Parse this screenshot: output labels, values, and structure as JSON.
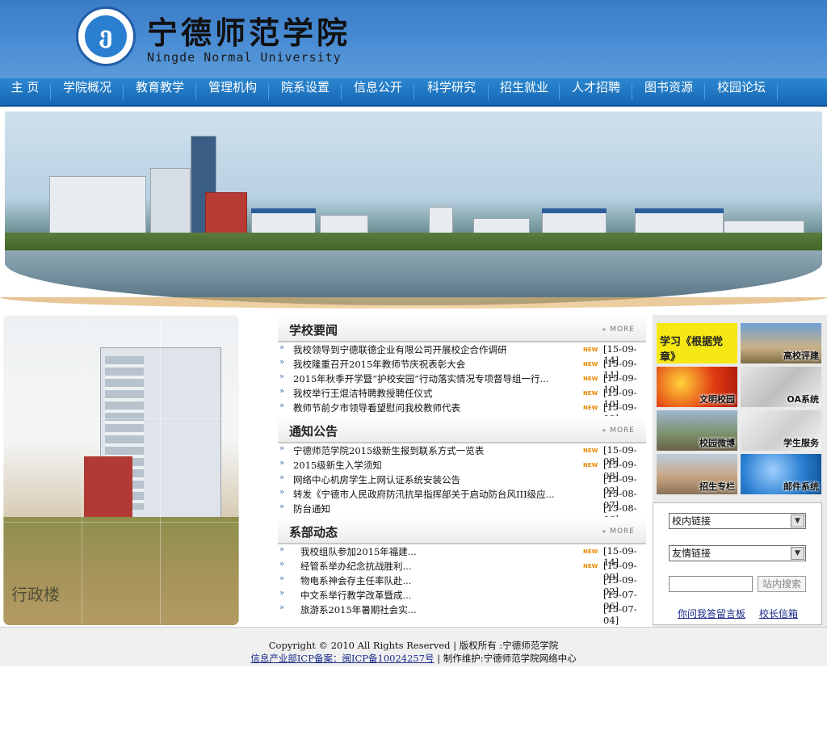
{
  "header": {
    "logo_mark": "ე",
    "title": "宁德师范学院",
    "subtitle": "Ningde Normal University"
  },
  "nav": {
    "items": [
      "主 页",
      "学院概况",
      "教育教学",
      "管理机构",
      "院系设置",
      "信息公开",
      "科学研究",
      "招生就业",
      "人才招聘",
      "图书资源",
      "校园论坛"
    ]
  },
  "left_photo": {
    "caption": "行政楼"
  },
  "news": {
    "school": {
      "title": "学校要闻",
      "more": "MORE",
      "items": [
        {
          "text": "我校领导到宁德联德企业有限公司开展校企合作调研",
          "new": "NEW",
          "date": "[15-09-14]"
        },
        {
          "text": "我校隆重召开2015年教师节庆祝表彰大会",
          "new": "NEW",
          "date": "[15-09-11]"
        },
        {
          "text": "2015年秋季开学暨“护校安园”行动落实情况专项督导组一行...",
          "new": "NEW",
          "date": "[15-09-10]"
        },
        {
          "text": "我校举行王焜洁特聘教授聘任仪式",
          "new": "NEW",
          "date": "[15-09-10]"
        },
        {
          "text": "教师节前夕市领导看望慰问我校教师代表",
          "new": "NEW",
          "date": "[15-09-09]"
        }
      ]
    },
    "notice": {
      "title": "通知公告",
      "more": "MORE",
      "items": [
        {
          "text": "宁德师范学院2015级新生报到联系方式一览表",
          "new": "NEW",
          "date": "[15-09-08]"
        },
        {
          "text": "2015级新生入学须知",
          "new": "NEW",
          "date": "[15-09-08]"
        },
        {
          "text": "网络中心机房学生上网认证系统安装公告",
          "new": "",
          "date": "[15-09-02]"
        },
        {
          "text": "转发《宁德市人民政府防汛抗旱指挥部关于启动防台风III级应...",
          "new": "",
          "date": "[15-08-07]"
        },
        {
          "text": "防台通知",
          "new": "",
          "date": "[15-08-06]"
        }
      ]
    },
    "dept": {
      "title": "系部动态",
      "more": "MORE",
      "items": [
        {
          "text": "我校组队参加2015年福建...",
          "new": "NEW",
          "date": "[15-09-14]"
        },
        {
          "text": "经管系举办纪念抗战胜利...",
          "new": "NEW",
          "date": "[15-09-09]"
        },
        {
          "text": "物电系神会存主任率队赴...",
          "new": "",
          "date": "[15-09-02]"
        },
        {
          "text": "中文系举行教学改革暨成...",
          "new": "",
          "date": "[15-07-06]"
        },
        {
          "text": "旅游系2015年暑期社会实...",
          "new": "",
          "date": "[15-07-04]"
        }
      ]
    }
  },
  "tiles": [
    {
      "label": "学习《根据党章》",
      "icon": "study-banner"
    },
    {
      "label": "高校评建",
      "icon": "building-photo"
    },
    {
      "label": "文明校园",
      "icon": "flag-photo"
    },
    {
      "label": "OA系统",
      "icon": "pen-photo"
    },
    {
      "label": "校园微博",
      "icon": "campus-photo"
    },
    {
      "label": "学生服务",
      "icon": "book-photo"
    },
    {
      "label": "招生专栏",
      "icon": "campus-photo"
    },
    {
      "label": "邮件系统",
      "icon": "mail-photo"
    }
  ],
  "links": {
    "internal_select": "校内链接",
    "friend_select": "友情链接",
    "search_placeholder": "",
    "search_button": "站内搜索",
    "ask_link": "你问我答留言板",
    "mailbox_link": "校长信箱"
  },
  "footer": {
    "copyright": "Copyright © 2010 All Rights Reserved  |  版权所有 :宁德师范学院",
    "icp": "信息产业部ICP备案：闽ICP备10024257号",
    "maintainer": " | 制作维护:宁德师范学院网络中心"
  },
  "colors": {
    "header_blue": "#4b8dd4",
    "nav_blue": "#1767b4",
    "new_tag": "#e68a00",
    "link_blue": "#1a2a8a"
  }
}
